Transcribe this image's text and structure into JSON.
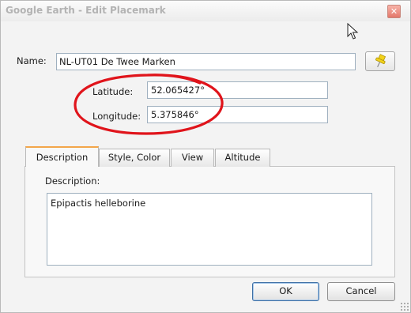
{
  "window": {
    "title": "Google Earth - Edit Placemark",
    "close_glyph": "✕"
  },
  "name": {
    "label": "Name:",
    "value": "NL-UT01 De Twee Marken"
  },
  "latitude": {
    "label": "Latitude:",
    "value": "52.065427°"
  },
  "longitude": {
    "label": "Longitude:",
    "value": "5.375846°"
  },
  "tabs": [
    {
      "label": "Description",
      "active": true
    },
    {
      "label": "Style, Color",
      "active": false
    },
    {
      "label": "View",
      "active": false
    },
    {
      "label": "Altitude",
      "active": false
    }
  ],
  "description": {
    "label": "Description:",
    "value": "Epipactis helleborine"
  },
  "buttons": {
    "ok": "OK",
    "cancel": "Cancel"
  },
  "icons": {
    "pin": "yellow-pushpin-icon",
    "cursor": "mouse-pointer-icon",
    "close": "close-icon"
  },
  "colors": {
    "annotation_ellipse": "#e0141b",
    "active_tab_accent": "#f3a64a",
    "pin": "#f2d21a"
  }
}
